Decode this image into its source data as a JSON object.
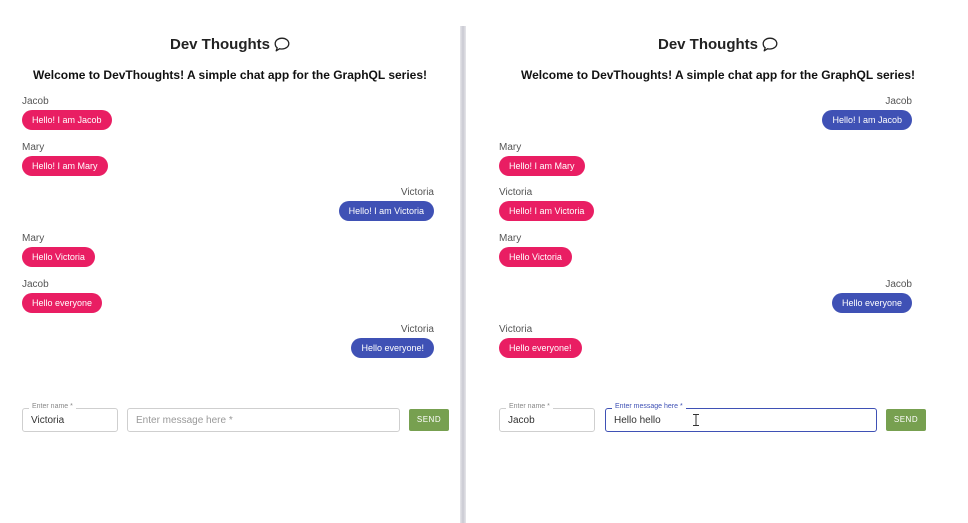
{
  "app": {
    "title": "Dev Thoughts",
    "subtitle": "Welcome to DevThoughts! A simple chat app for the GraphQL series!",
    "colors": {
      "other_bubble": "#e91e63",
      "own_bubble": "#3f51b5",
      "send_button": "#77a050"
    },
    "title_icon": "chat-bubble-icon"
  },
  "left": {
    "messages": [
      {
        "sender": "Jacob",
        "text": "Hello! I am Jacob"
      },
      {
        "sender": "Mary",
        "text": "Hello! I am Mary"
      },
      {
        "sender": "Victoria",
        "text": "Hello! I am Victoria"
      },
      {
        "sender": "Mary",
        "text": "Hello Victoria"
      },
      {
        "sender": "Jacob",
        "text": "Hello everyone"
      },
      {
        "sender": "Victoria",
        "text": "Hello everyone!"
      }
    ],
    "name_label": "Enter name *",
    "name_value": "Victoria",
    "message_placeholder": "Enter message here *",
    "send_label": "SEND"
  },
  "right": {
    "messages": [
      {
        "sender": "Jacob",
        "text": "Hello! I am Jacob"
      },
      {
        "sender": "Mary",
        "text": "Hello! I am Mary"
      },
      {
        "sender": "Victoria",
        "text": "Hello! I am Victoria"
      },
      {
        "sender": "Mary",
        "text": "Hello Victoria"
      },
      {
        "sender": "Jacob",
        "text": "Hello everyone"
      },
      {
        "sender": "Victoria",
        "text": "Hello everyone!"
      }
    ],
    "name_label": "Enter name *",
    "name_value": "Jacob",
    "message_label": "Enter message here *",
    "message_value": "Hello hello",
    "send_label": "SEND"
  }
}
